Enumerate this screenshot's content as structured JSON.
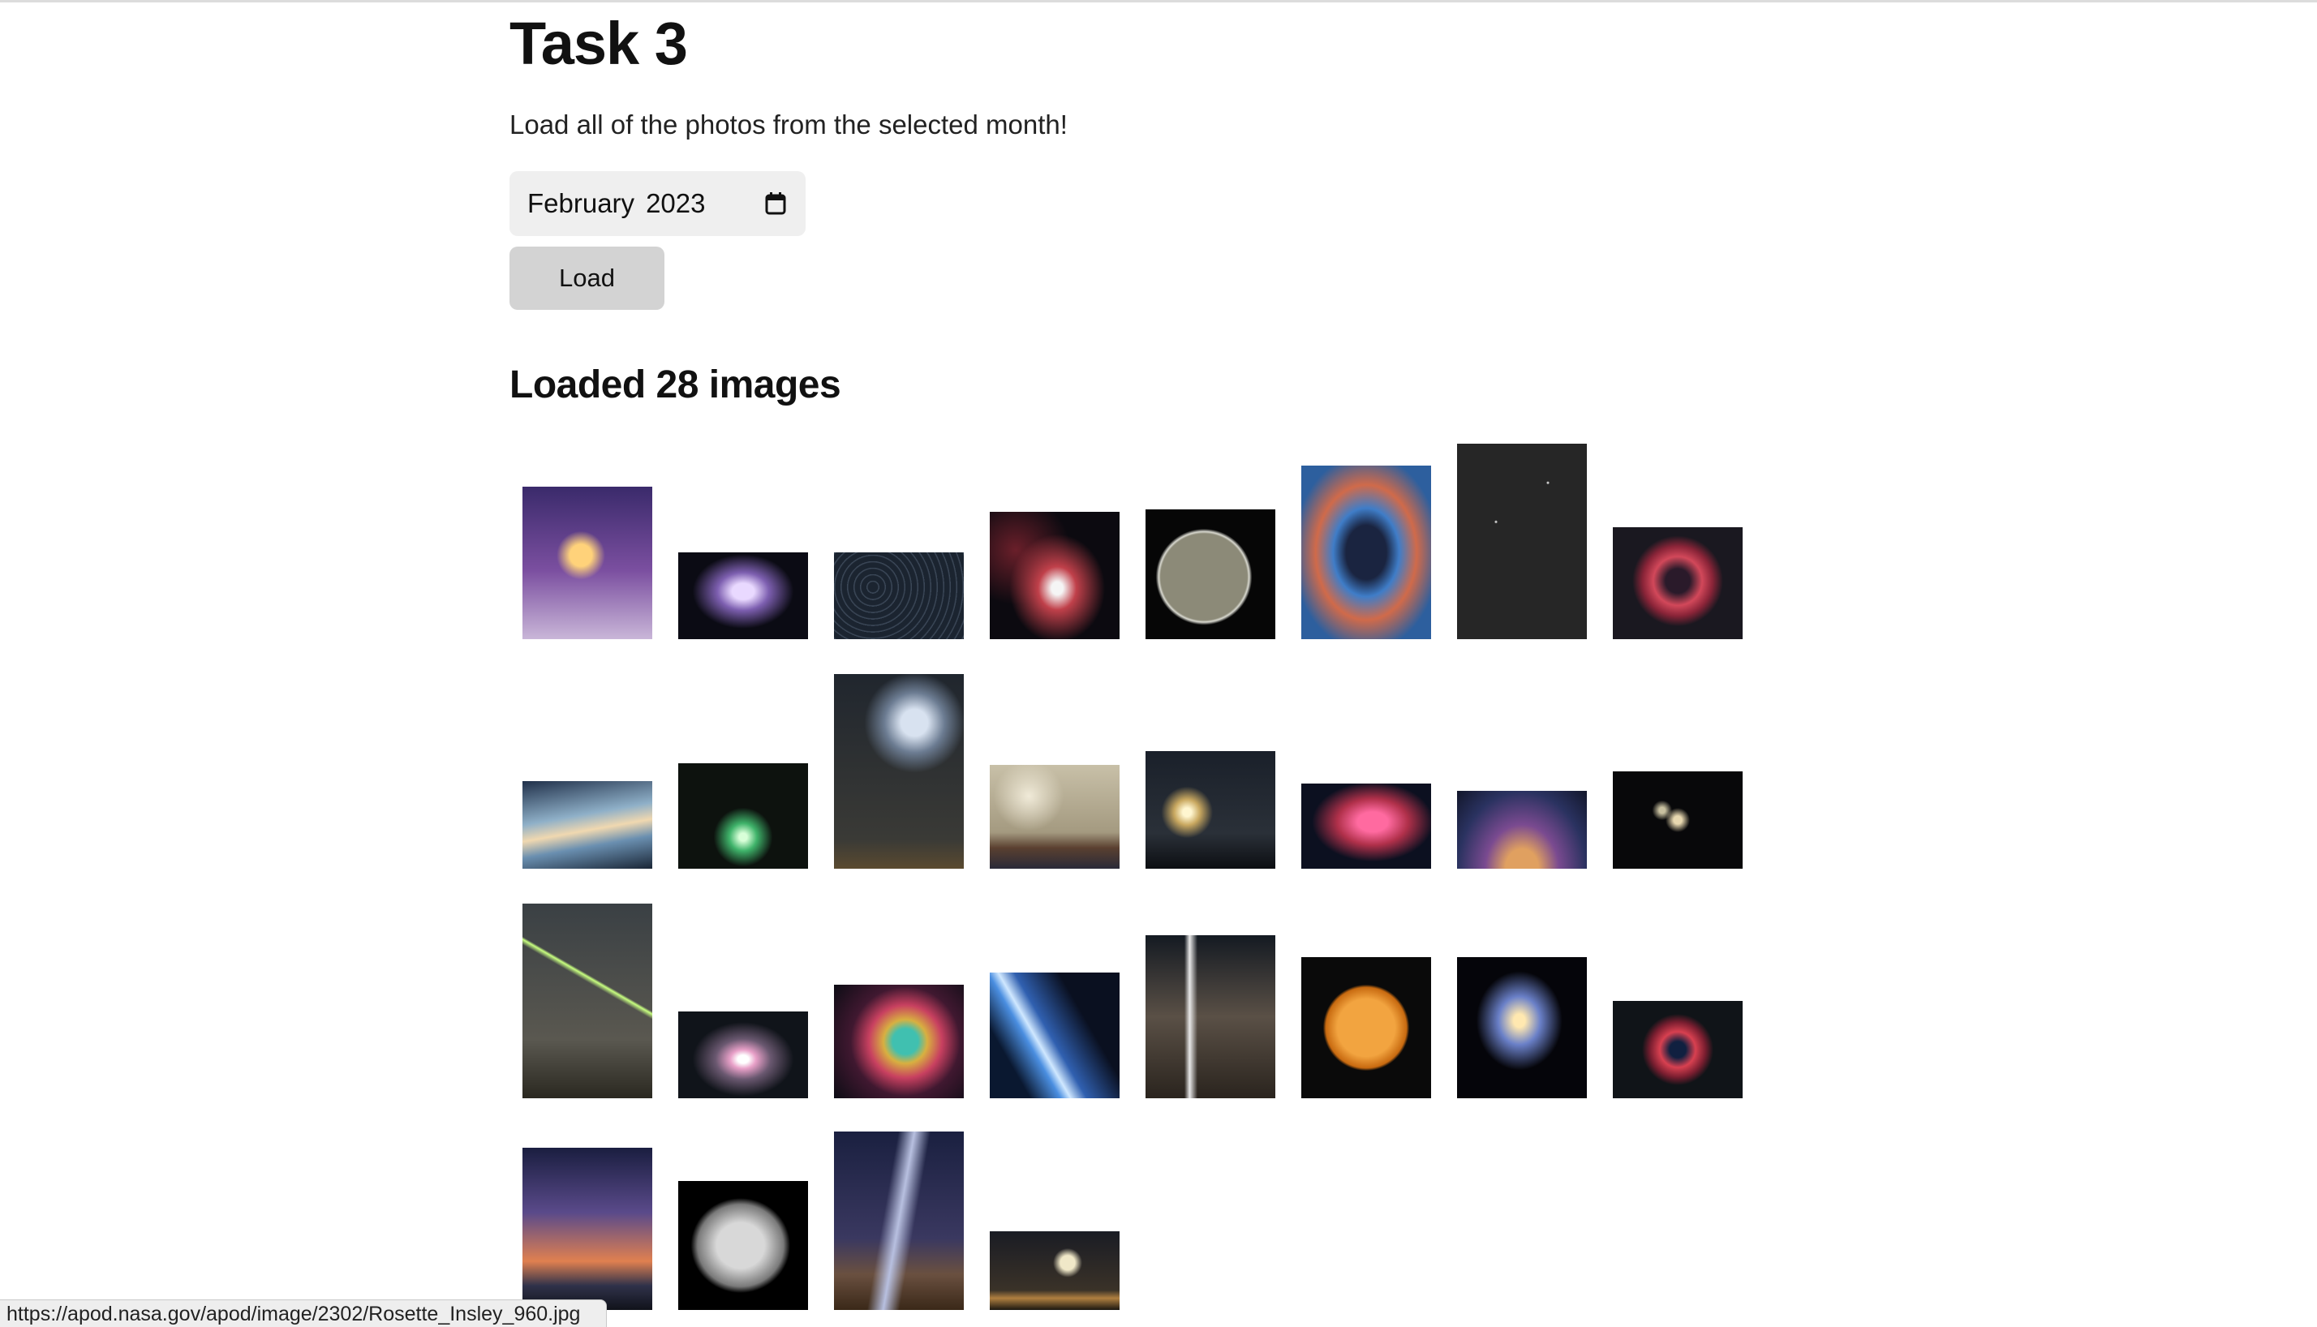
{
  "page": {
    "title": "Task 3",
    "description": "Load all of the photos from the selected month!"
  },
  "month_input": {
    "month": "February",
    "year": "2023",
    "icon": "calendar-icon"
  },
  "load_button": {
    "label": "Load"
  },
  "results": {
    "heading": "Loaded 28 images",
    "images": [
      {
        "kind": "rock-sunset"
      },
      {
        "kind": "orion-nebula"
      },
      {
        "kind": "star-trails"
      },
      {
        "kind": "dark-nebula"
      },
      {
        "kind": "moon-crescent"
      },
      {
        "kind": "rosette-nebula"
      },
      {
        "kind": "big-dipper"
      },
      {
        "kind": "red-nebula"
      },
      {
        "kind": "nacreous-clouds"
      },
      {
        "kind": "green-comet"
      },
      {
        "kind": "magellanic-clouds"
      },
      {
        "kind": "mammatus-clouds"
      },
      {
        "kind": "comet-mountain"
      },
      {
        "kind": "heart-nebula"
      },
      {
        "kind": "airglow-panorama"
      },
      {
        "kind": "galaxy-group"
      },
      {
        "kind": "meteor-tree"
      },
      {
        "kind": "galaxy-dust"
      },
      {
        "kind": "colorful-nebula"
      },
      {
        "kind": "veil-nebula"
      },
      {
        "kind": "waterfall-night"
      },
      {
        "kind": "sun-disk"
      },
      {
        "kind": "spiral-galaxy"
      },
      {
        "kind": "planetary-nebula"
      },
      {
        "kind": "venus-twilight"
      },
      {
        "kind": "asteroid"
      },
      {
        "kind": "zodiacal-light"
      },
      {
        "kind": "moon-temple"
      }
    ]
  },
  "status_bar": {
    "url": "https://apod.nasa.gov/apod/image/2302/Rosette_Insley_960.jpg"
  }
}
